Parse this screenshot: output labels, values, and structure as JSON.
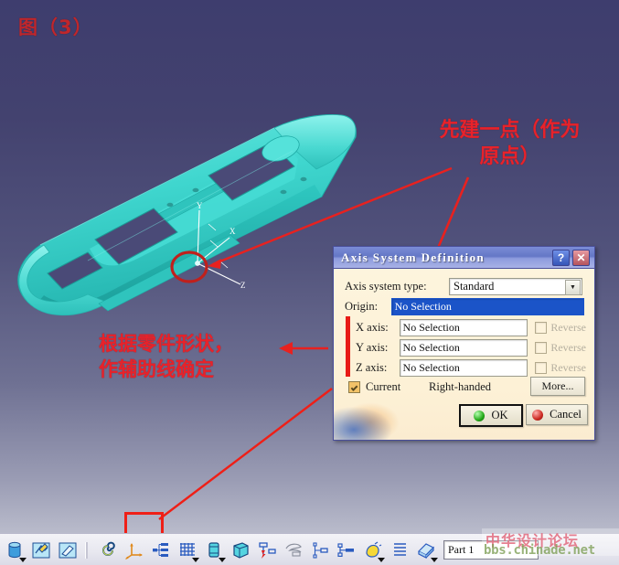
{
  "figure": {
    "caption": "图（3）"
  },
  "annotations": {
    "top_right": "先建一点（作为\n原点）",
    "bottom_left": "根据零件形状，\n作辅助线确定"
  },
  "viewport": {
    "axis_labels": {
      "x": "X",
      "y": "Y",
      "z": "Z"
    },
    "background_top_color": "#3e3d6e",
    "background_bottom_color": "#b9bbcb",
    "model_color": "#3fd8d0",
    "highlight_circle_color": "#c0201c"
  },
  "dialog": {
    "title": "Axis System Definition",
    "titlebar": {
      "help_label": "?",
      "close_label": "✕"
    },
    "axis_system_type": {
      "label": "Axis system type:",
      "value": "Standard",
      "options": [
        "Standard"
      ]
    },
    "origin": {
      "label": "Origin:",
      "value": "No Selection",
      "selected": true
    },
    "axes": [
      {
        "label": "X axis:",
        "value": "No Selection",
        "reverse_label": "Reverse",
        "reverse_checked": false
      },
      {
        "label": "Y axis:",
        "value": "No Selection",
        "reverse_label": "Reverse",
        "reverse_checked": false
      },
      {
        "label": "Z axis:",
        "value": "No Selection",
        "reverse_label": "Reverse",
        "reverse_checked": false
      }
    ],
    "current": {
      "label": "Current",
      "checked": true
    },
    "handedness": "Right-handed",
    "more_button": "More...",
    "ok_button": "OK",
    "cancel_button": "Cancel",
    "accent_red": "#e81b16",
    "selection_blue": "#1b54c8",
    "body_background": "#fdf3dc"
  },
  "toolbar": {
    "items": [
      {
        "name": "material-cylinder-icon",
        "has_caret": true
      },
      {
        "name": "apply-material-icon",
        "has_caret": false
      },
      {
        "name": "paint-swatch-icon",
        "has_caret": false
      },
      {
        "name": "separator",
        "has_caret": false
      },
      {
        "name": "spiral-curve-icon",
        "has_caret": false
      },
      {
        "name": "axis-system-icon",
        "has_caret": false
      },
      {
        "name": "tree-structure-icon",
        "has_caret": false
      },
      {
        "name": "grid-pattern-icon",
        "has_caret": true
      },
      {
        "name": "cylinder-solid-icon",
        "has_caret": true
      },
      {
        "name": "box-wireframe-icon",
        "has_caret": false
      },
      {
        "name": "transform-icon",
        "has_caret": false
      },
      {
        "name": "sketch-tracer-icon",
        "has_caret": false
      },
      {
        "name": "tree-node-icon",
        "has_caret": false
      },
      {
        "name": "outline-tree-icon",
        "has_caret": false
      },
      {
        "name": "highlight-lamp-icon",
        "has_caret": true
      },
      {
        "name": "list-lines-icon",
        "has_caret": false
      },
      {
        "name": "catalog-book-icon",
        "has_caret": true
      }
    ],
    "part_field": {
      "value": "Part 1",
      "placeholder": "Part"
    }
  },
  "watermark": {
    "chinese": "中华设计论坛",
    "url": "bbs.chinade.net"
  }
}
